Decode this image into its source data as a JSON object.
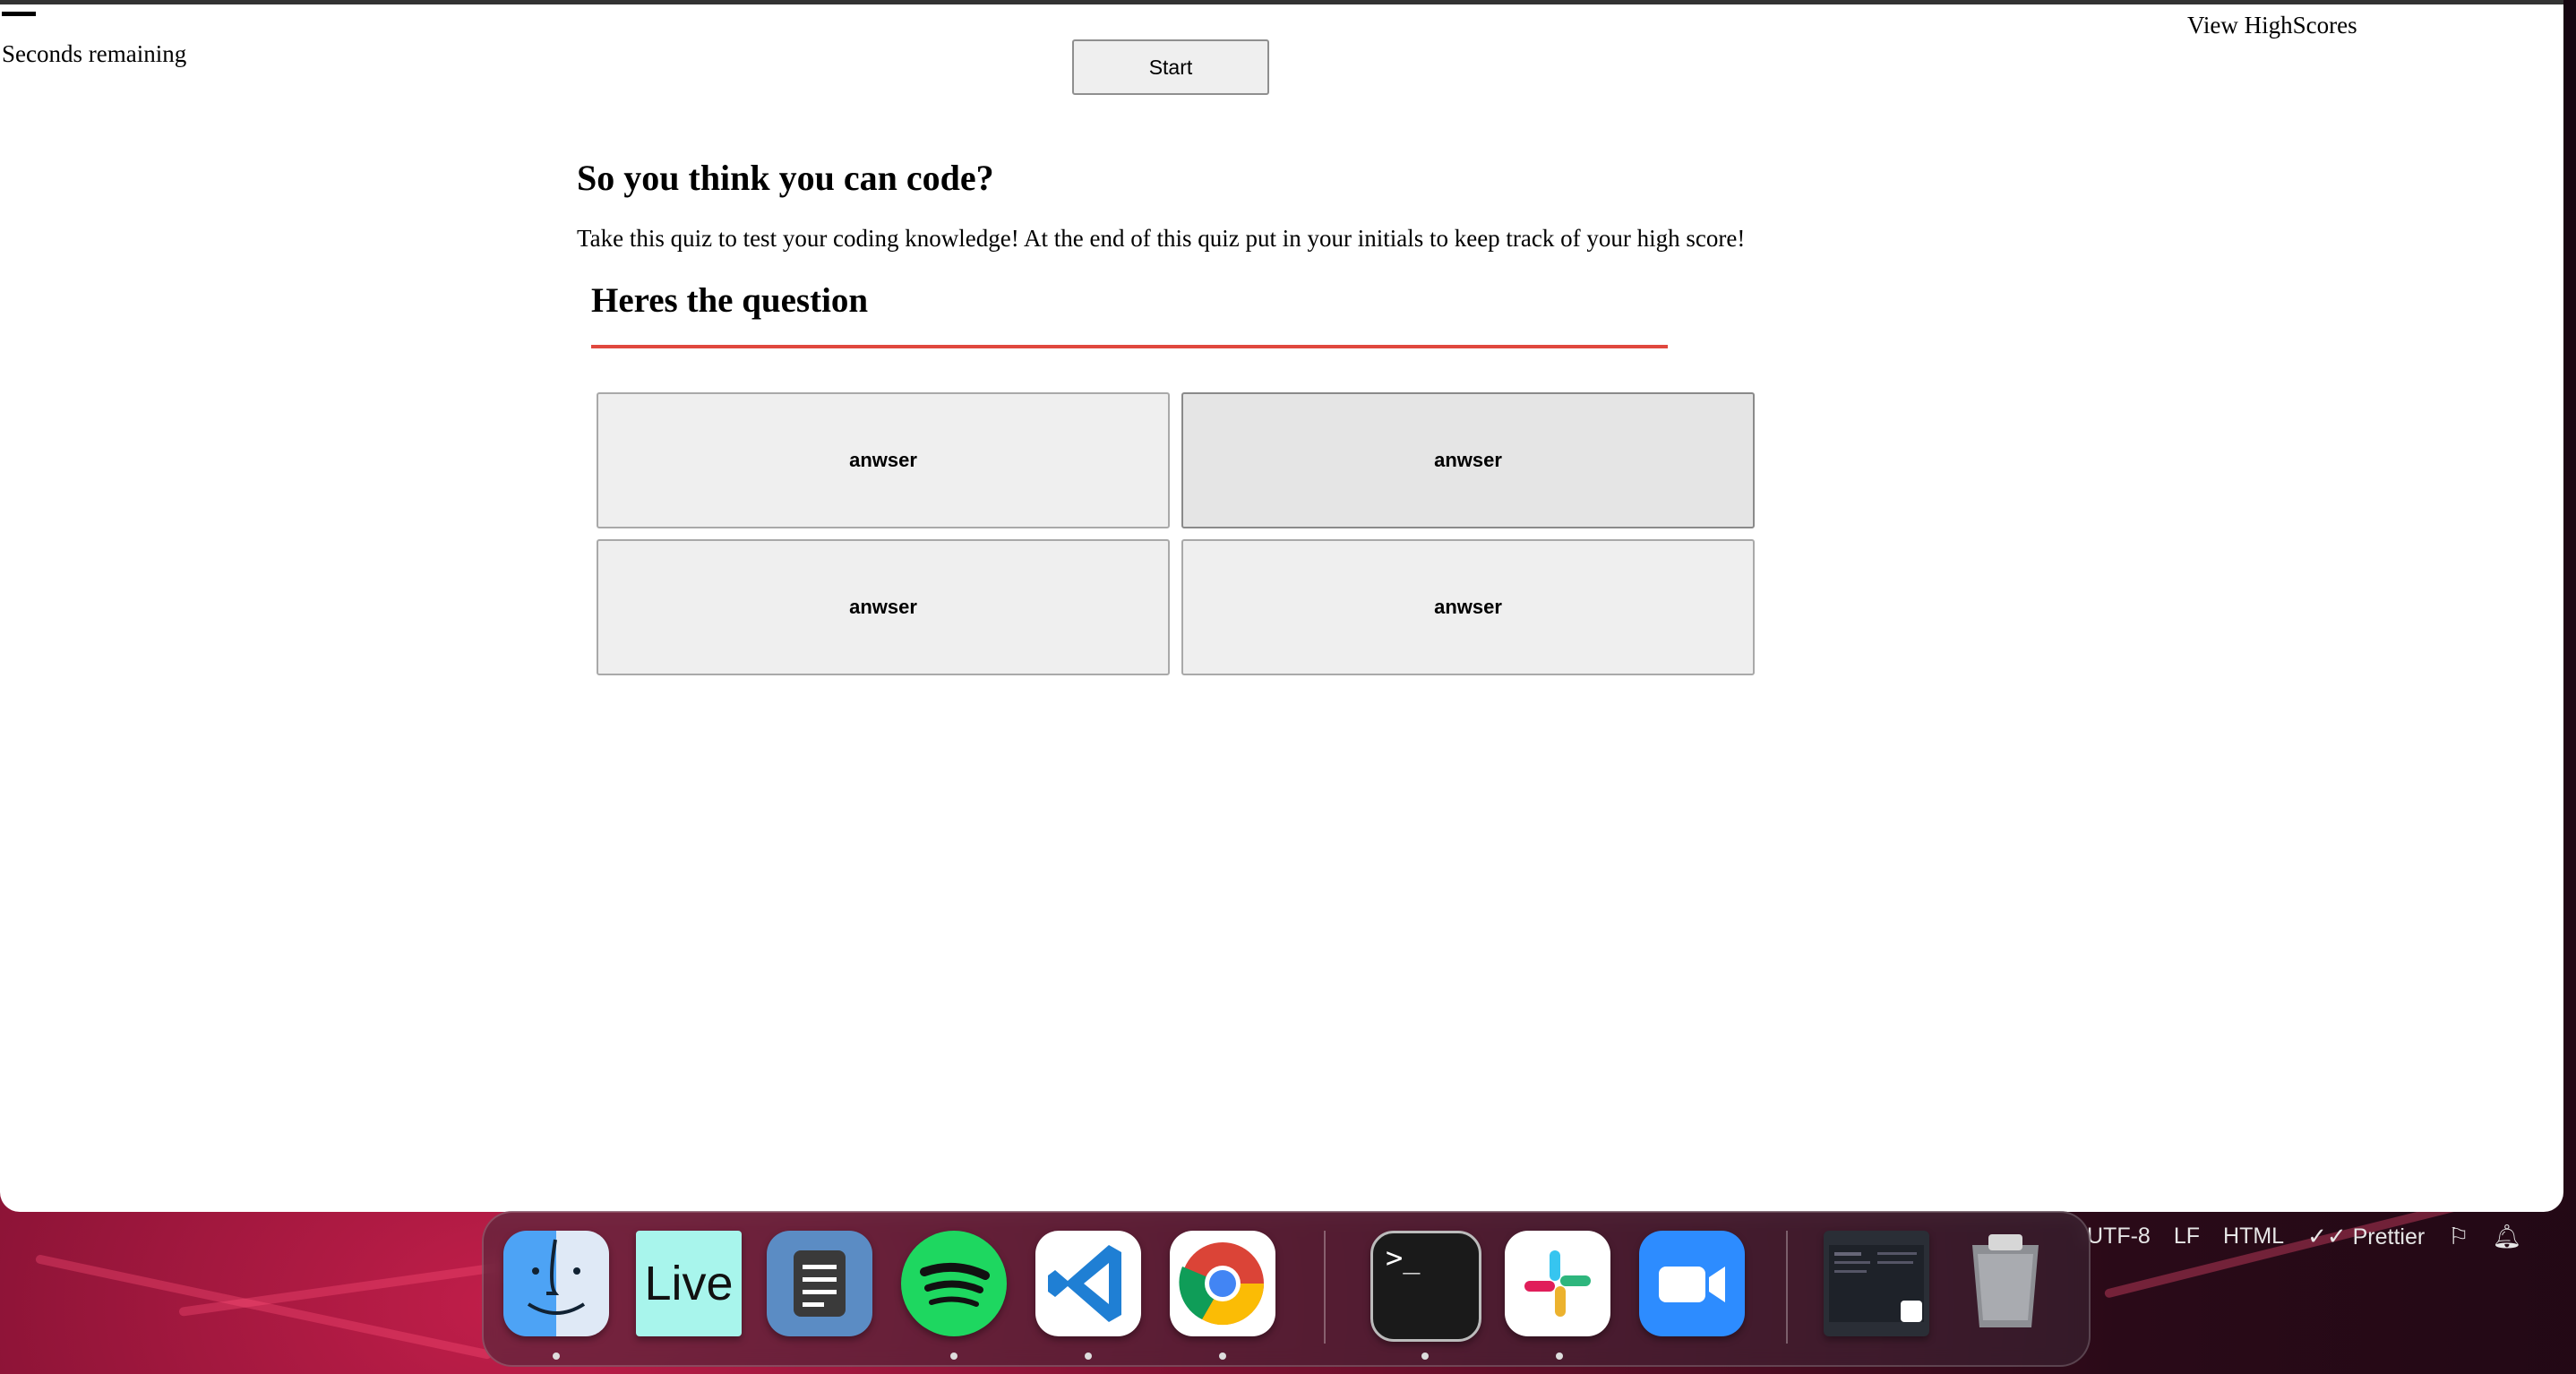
{
  "page": {
    "seconds_label": "Seconds remaining",
    "highscores_label": "View HighScores",
    "start_label": "Start",
    "title": "So you think you can code?",
    "description": "Take this quiz to test your coding knowledge! At the end of this quiz put in your initials to keep track of your high score!",
    "question": "Heres the question",
    "answers": [
      "anwser",
      "anwser",
      "anwser",
      "anwser"
    ],
    "accent_color": "#e0483e"
  },
  "statusbar": {
    "encoding": "UTF-8",
    "line_ending": "LF",
    "language": "HTML",
    "formatter": "Prettier"
  },
  "dock": {
    "apps": [
      {
        "name": "Finder",
        "icon": "finder-icon",
        "running": true
      },
      {
        "name": "Live",
        "icon": "live-icon",
        "running": false,
        "label": "Live"
      },
      {
        "name": "Notes",
        "icon": "document-icon",
        "running": false
      },
      {
        "name": "Spotify",
        "icon": "spotify-icon",
        "running": true
      },
      {
        "name": "Visual Studio Code",
        "icon": "vscode-icon",
        "running": true
      },
      {
        "name": "Google Chrome",
        "icon": "chrome-icon",
        "running": true
      },
      {
        "name": "Terminal",
        "icon": "terminal-icon",
        "running": true
      },
      {
        "name": "Slack",
        "icon": "slack-icon",
        "running": true
      },
      {
        "name": "Zoom",
        "icon": "zoom-icon",
        "running": false
      },
      {
        "name": "Minimized Window",
        "icon": "window-thumbnail-icon",
        "running": false
      },
      {
        "name": "Trash",
        "icon": "trash-icon",
        "running": false
      }
    ]
  }
}
